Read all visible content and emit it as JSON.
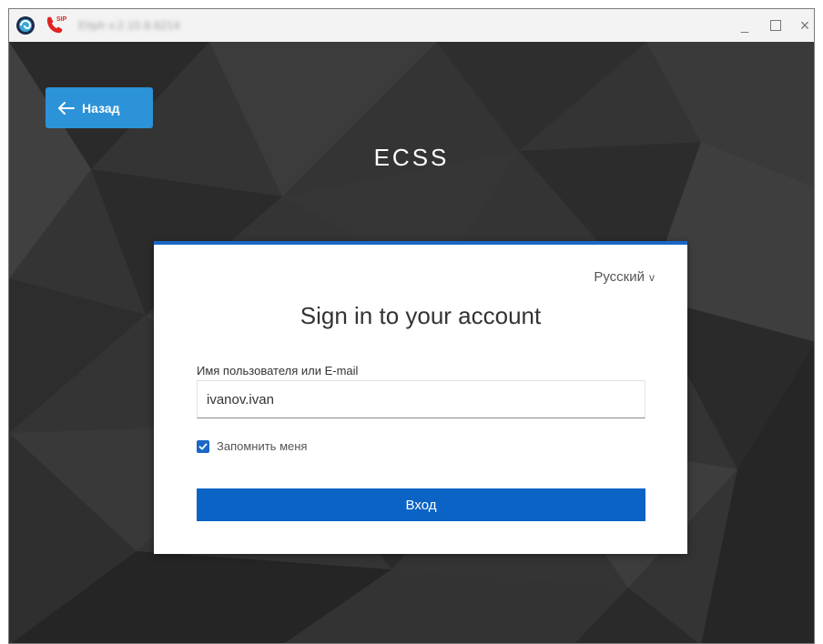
{
  "window": {
    "title": "Eltph v.2.10.8.6214",
    "controls": {
      "minimize": "_",
      "close": "×"
    }
  },
  "app": {
    "icon": "eltex-app-icon",
    "sip_icon": "sip-phone-icon",
    "sip_badge": "SIP"
  },
  "page": {
    "back_label": "Назад",
    "brand": "ECSS"
  },
  "login": {
    "language": "Русский",
    "heading": "Sign in to your account",
    "username_label": "Имя пользователя или E-mail",
    "username_value": "ivanov.ivan",
    "remember_label": "Запомнить меня",
    "remember_checked": true,
    "submit_label": "Вход"
  },
  "colors": {
    "accent_top": "#1a67c7",
    "button": "#0b63c5",
    "back_button": "#2c93d9",
    "background": "#2f2f2f"
  }
}
